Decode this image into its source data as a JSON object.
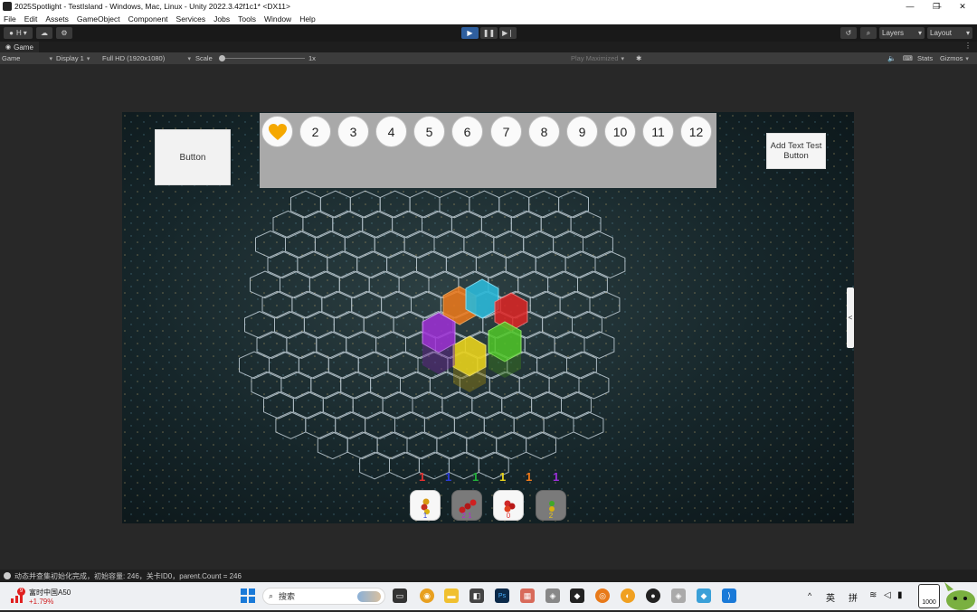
{
  "window": {
    "title": "2025Spotlight - TestIsland - Windows, Mac, Linux - Unity 2022.3.42f1c1* <DX11>",
    "controls": [
      "—",
      "❐",
      "✕"
    ]
  },
  "menu": [
    "File",
    "Edit",
    "Assets",
    "GameObject",
    "Component",
    "Services",
    "Jobs",
    "Tools",
    "Window",
    "Help"
  ],
  "toolbar": {
    "account_label": "H",
    "layers_label": "Layers",
    "layout_label": "Layout"
  },
  "tab": {
    "label": "Game"
  },
  "gamebar": {
    "mode": "Game",
    "display": "Display 1",
    "resolution": "Full HD (1920x1080)",
    "scale_label": "Scale",
    "scale_value": "1x",
    "play_mode": "Play Maximized",
    "stats": "Stats",
    "gizmos": "Gizmos"
  },
  "game_ui": {
    "button_label": "Button",
    "levels": [
      "2",
      "3",
      "4",
      "5",
      "6",
      "7",
      "8",
      "9",
      "10",
      "11",
      "12"
    ],
    "add_text_button": "Add Text Test Button",
    "side_handle": "<",
    "counts": [
      {
        "value": "1",
        "color": "#e53030"
      },
      {
        "value": "1",
        "color": "#2a3ad8"
      },
      {
        "value": "1",
        "color": "#23b03a"
      },
      {
        "value": "1",
        "color": "#e8d21c"
      },
      {
        "value": "1",
        "color": "#f07a1a"
      },
      {
        "value": "1",
        "color": "#9b2fd8"
      }
    ],
    "slots": [
      {
        "num": "1",
        "num_color": "#3040d0",
        "style": "white"
      },
      {
        "num": "2 1",
        "num_color": "#b02bd0",
        "style": "grey"
      },
      {
        "num": "0",
        "num_color": "#e03030",
        "style": "white"
      },
      {
        "num": "2",
        "num_color": "#e8c81c",
        "style": "grey"
      }
    ]
  },
  "status": {
    "text": "动态并查集初始化完成，初始容量: 246，关卡ID0，parent.Count = 246"
  },
  "taskbar": {
    "stock_name": "富时中国A50",
    "stock_change": "+1.79%",
    "stock_badge": "9",
    "search_placeholder": "搜索",
    "ime_lang": "英",
    "ime_mode": "拼",
    "tray_badge": "1000"
  }
}
